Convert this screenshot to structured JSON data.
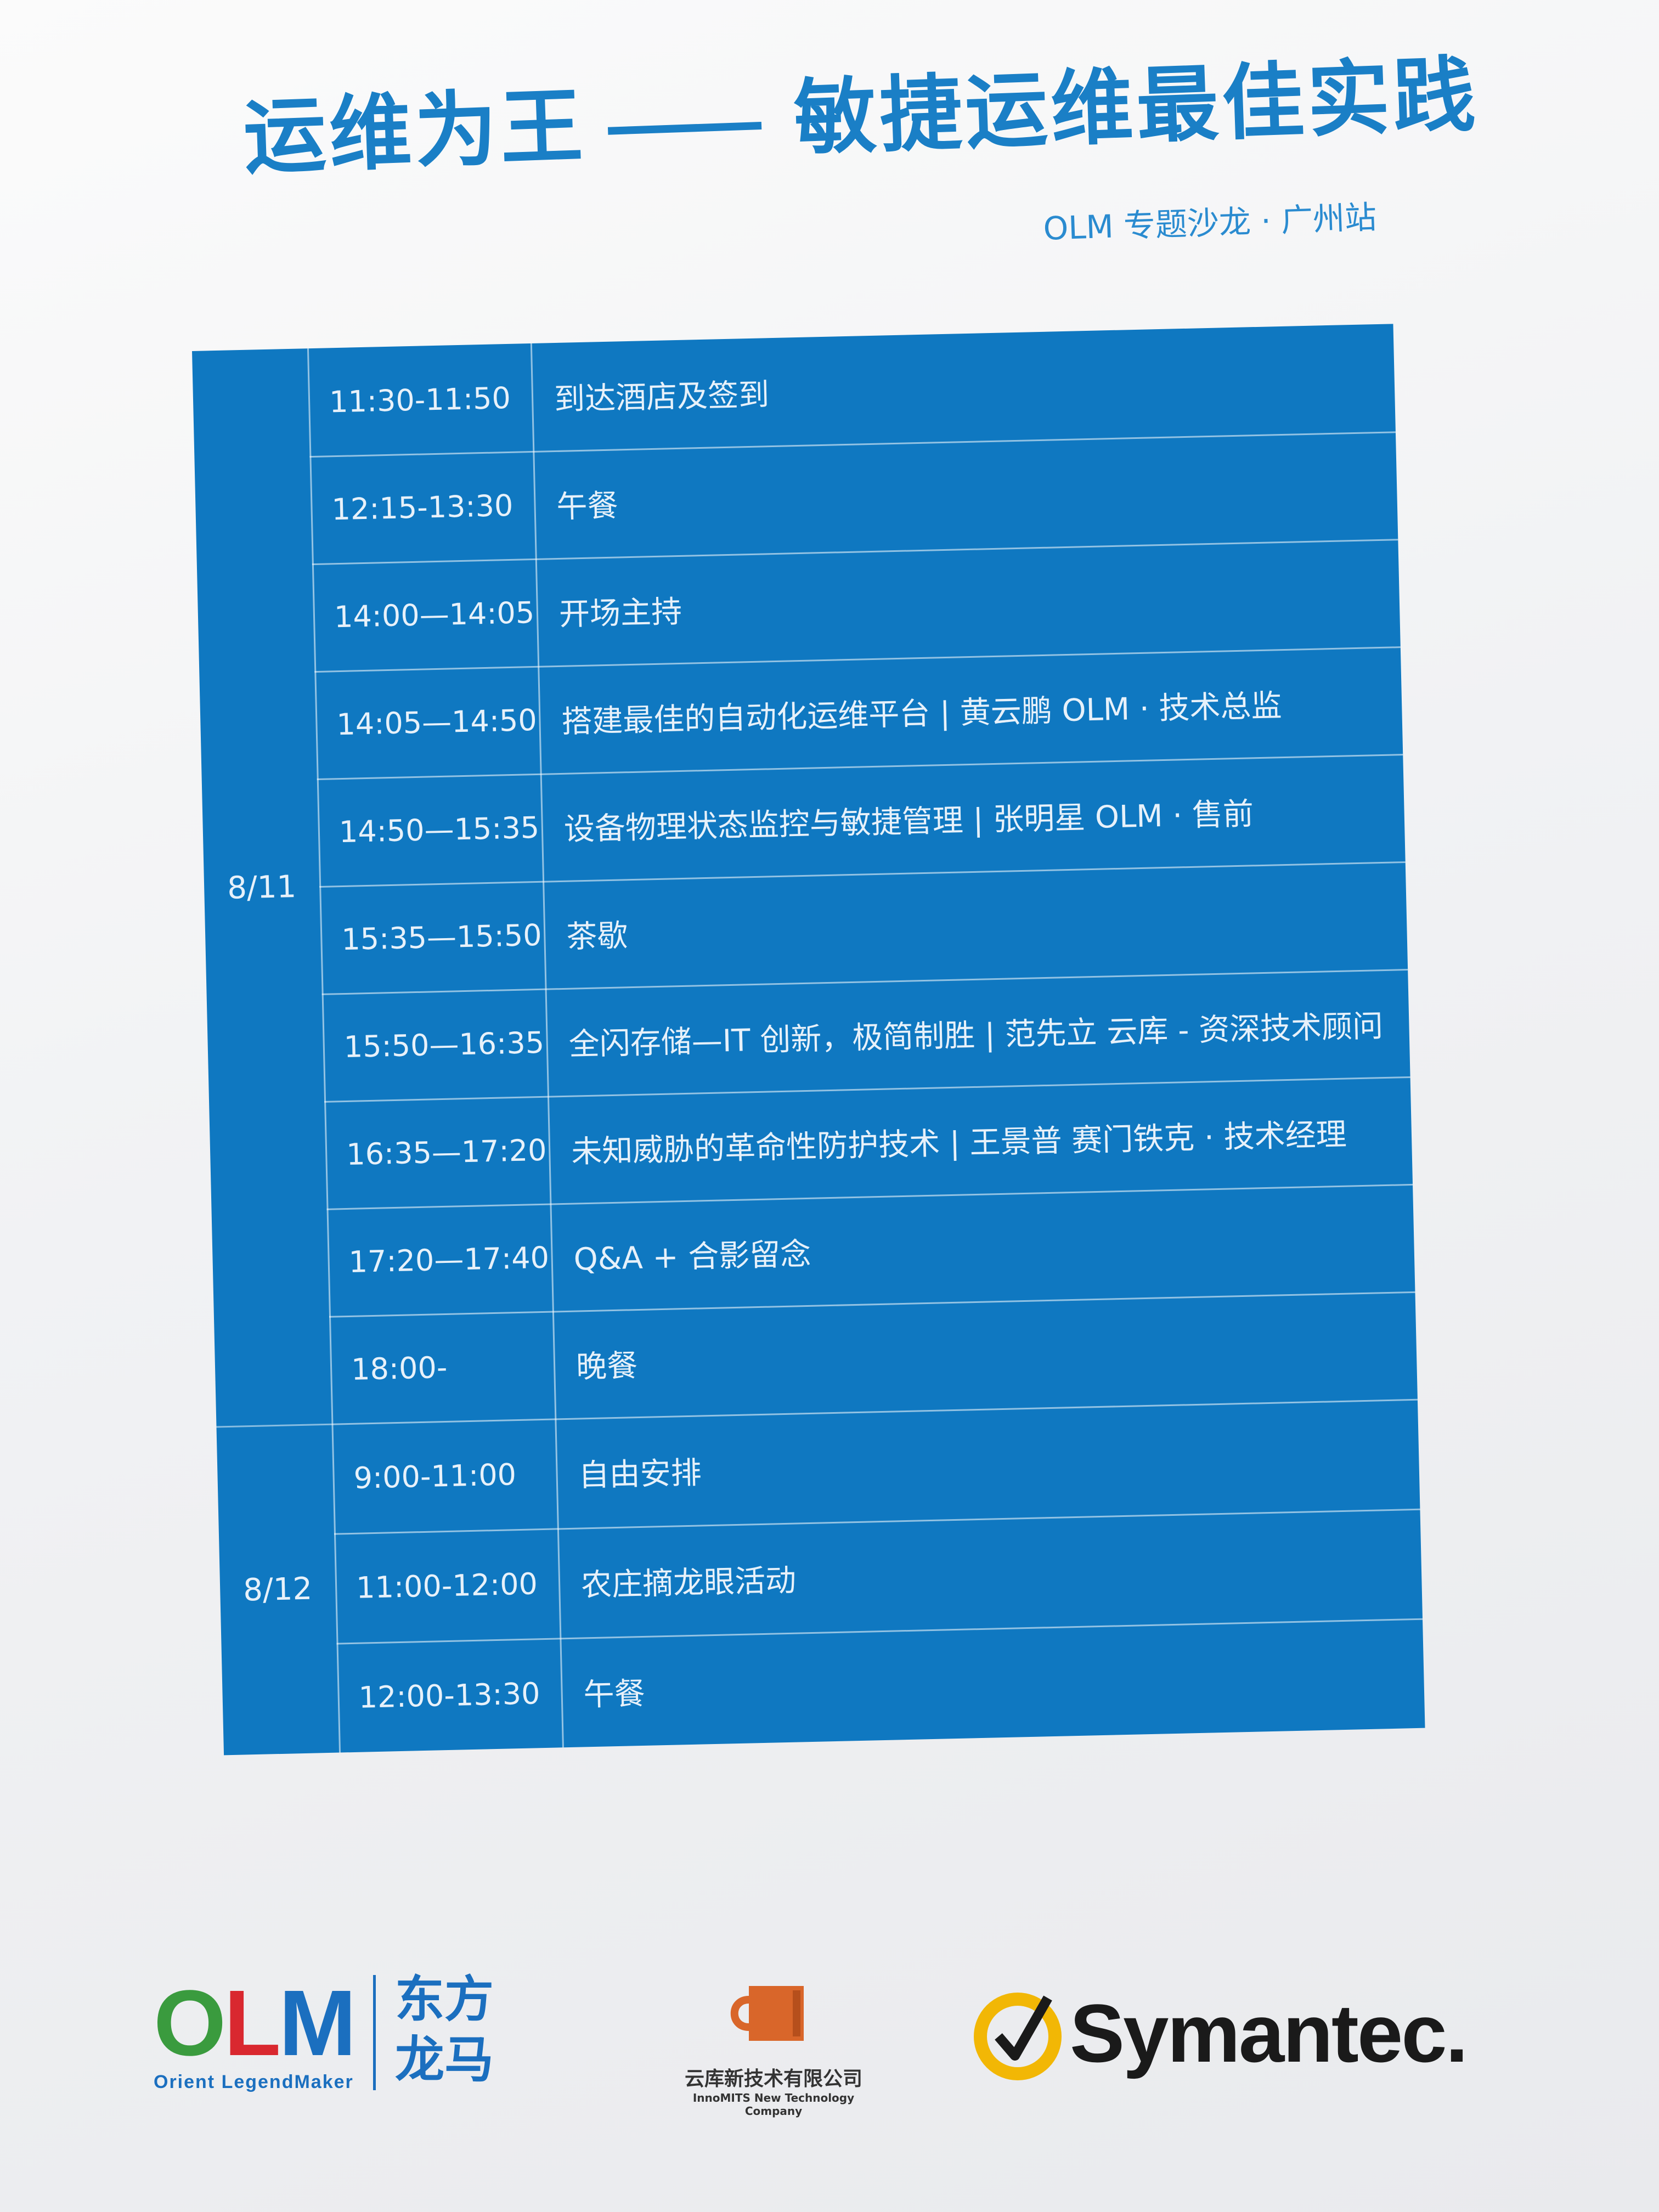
{
  "header": {
    "title_left": "运维为王",
    "title_right": "敏捷运维最佳实践",
    "subtitle": "OLM 专题沙龙 · 广州站"
  },
  "schedule": {
    "days": [
      {
        "date": "8/11",
        "rows": [
          {
            "time": "11:30-11:50",
            "event": "到达酒店及签到"
          },
          {
            "time": "12:15-13:30",
            "event": "午餐"
          },
          {
            "time": "14:00—14:05",
            "event": "开场主持"
          },
          {
            "time": "14:05—14:50",
            "event": "搭建最佳的自动化运维平台 | 黄云鹏 OLM · 技术总监"
          },
          {
            "time": "14:50—15:35",
            "event": "设备物理状态监控与敏捷管理 | 张明星 OLM · 售前"
          },
          {
            "time": "15:35—15:50",
            "event": "茶歇"
          },
          {
            "time": "15:50—16:35",
            "event": "全闪存储—IT 创新，极简制胜 | 范先立  云库 - 资深技术顾问"
          },
          {
            "time": "16:35—17:20",
            "event": "未知威胁的革命性防护技术 | 王景普 赛门铁克 · 技术经理"
          },
          {
            "time": "17:20—17:40",
            "event": "Q&A + 合影留念"
          },
          {
            "time": "18:00-",
            "event": "晚餐"
          }
        ]
      },
      {
        "date": "8/12",
        "rows": [
          {
            "time": "9:00-11:00",
            "event": "自由安排"
          },
          {
            "time": "11:00-12:00",
            "event": "农庄摘龙眼活动"
          },
          {
            "time": "12:00-13:30",
            "event": "午餐"
          }
        ]
      }
    ]
  },
  "logos": {
    "olm": {
      "o": "O",
      "l": "L",
      "m": "M",
      "tagline": "Orient LegendMaker",
      "cn_line1": "东方",
      "cn_line2": "龙马"
    },
    "yunku": {
      "name": "云库新技术有限公司",
      "en": "InnoMITS New Technology Company"
    },
    "symantec": {
      "name": "Symantec."
    }
  },
  "colors": {
    "brand_blue": "#0f78c1",
    "title_blue": "#1a7fc6"
  }
}
